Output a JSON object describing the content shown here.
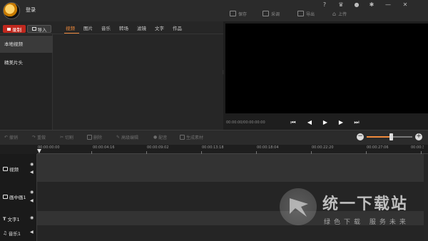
{
  "titlebar": {
    "login": "登录",
    "actions": {
      "save": "保存",
      "record": "采调",
      "export": "导出",
      "upload": "上传"
    },
    "window_icons": [
      "help-icon",
      "crown-icon",
      "bell-icon",
      "gear-icon",
      "minimize-icon",
      "close-icon"
    ]
  },
  "media": {
    "record_btn": "录制",
    "import_btn": "导入",
    "tabs": [
      "视频",
      "图片",
      "音乐",
      "转场",
      "滤镜",
      "文字",
      "作品"
    ],
    "active_tab": "视频",
    "sidebar": [
      "本地视频",
      "精美片头"
    ]
  },
  "preview": {
    "timecode": "00:00:00/00:00:00:00"
  },
  "toolbar": {
    "items": [
      "撤销",
      "重做",
      "切割",
      "删除",
      "高级编辑",
      "配音",
      "生成素材"
    ],
    "zoom_level": 0.53
  },
  "timeline": {
    "ruler_labels": [
      "00:00:00:00",
      "00:00:04:16",
      "00:00:09:02",
      "00:00:13:18",
      "00:00:18:04",
      "00:00:22:20",
      "00:00:27:06",
      "00:00:31:"
    ],
    "tracks": [
      "视频",
      "画中画1",
      "文字1",
      "音乐1"
    ]
  },
  "watermark": {
    "title": "统一下载站",
    "subtitle": "绿色下载  服务未来"
  },
  "colors": {
    "accent": "#f08a3c",
    "record": "#c0281e",
    "background": "#1e1e1e"
  }
}
